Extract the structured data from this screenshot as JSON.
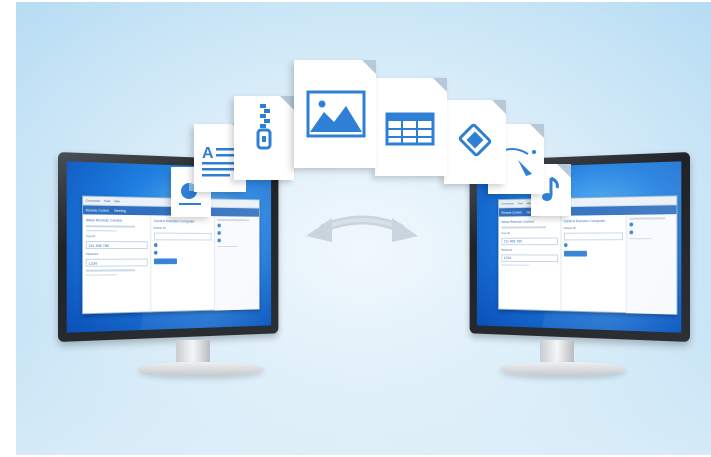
{
  "scene": {
    "colors": {
      "background": "#cfe7f6",
      "screen": "#1f7fe0",
      "accent": "#2f7fd4",
      "arrow": "#c9d4de"
    }
  },
  "left_monitor": {
    "app": {
      "menu": [
        "Connection",
        "Tools",
        "Help"
      ],
      "ribbon_tab": "Remote Control",
      "ribbon_tab2": "Meeting",
      "allow_title": "Allow Remote Control",
      "id_label": "Your ID",
      "id_value": "111 456 789",
      "password_label": "Password",
      "password_value": "1234",
      "control_title": "Control Remote Computer",
      "partner_label": "Partner ID",
      "connect_label": "Connect to partner",
      "status": "Ready to connect (secure connection)"
    }
  },
  "right_monitor": {
    "app": {
      "menu": [
        "Connection",
        "Tools",
        "Help"
      ],
      "ribbon_tab": "Remote Control",
      "ribbon_tab2": "Meeting",
      "allow_title": "Allow Remote Control",
      "id_label": "Your ID",
      "id_value": "111 456 789",
      "password_label": "Password",
      "password_value": "1234",
      "control_title": "Control Remote Computer",
      "partner_label": "Partner ID",
      "connect_label": "Connect to partner",
      "status": "Ready to connect (secure connection)"
    }
  },
  "files": [
    {
      "icon": "pie-chart-document-icon"
    },
    {
      "icon": "text-document-icon"
    },
    {
      "icon": "zip-archive-icon"
    },
    {
      "icon": "image-file-icon"
    },
    {
      "icon": "spreadsheet-file-icon"
    },
    {
      "icon": "video-file-icon"
    },
    {
      "icon": "vector-graphic-file-icon"
    },
    {
      "icon": "music-file-icon"
    }
  ],
  "sync_arrow": {
    "icon": "two-way-sync-arrow-icon"
  }
}
